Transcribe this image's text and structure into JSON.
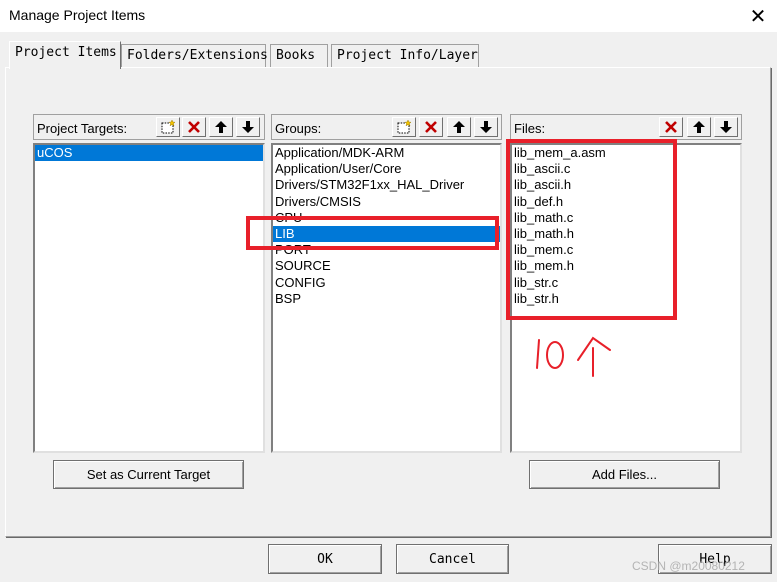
{
  "window": {
    "title": "Manage Project Items",
    "close_glyph": "✕"
  },
  "tabs": [
    {
      "label": "Project Items",
      "active": true
    },
    {
      "label": "Folders/Extensions",
      "active": false
    },
    {
      "label": "Books",
      "active": false
    },
    {
      "label": "Project Info/Layer",
      "active": false
    }
  ],
  "targets": {
    "header": "Project Targets:",
    "toolbar": [
      "new-icon",
      "delete-icon",
      "move-up-icon",
      "move-down-icon"
    ],
    "items": [
      {
        "label": "uCOS",
        "selected": true
      }
    ]
  },
  "groups": {
    "header": "Groups:",
    "toolbar": [
      "new-icon",
      "delete-icon",
      "move-up-icon",
      "move-down-icon"
    ],
    "items": [
      {
        "label": "Application/MDK-ARM",
        "selected": false
      },
      {
        "label": "Application/User/Core",
        "selected": false
      },
      {
        "label": "Drivers/STM32F1xx_HAL_Driver",
        "selected": false
      },
      {
        "label": "Drivers/CMSIS",
        "selected": false
      },
      {
        "label": "CPU",
        "selected": false
      },
      {
        "label": "LIB",
        "selected": true
      },
      {
        "label": "PORT",
        "selected": false
      },
      {
        "label": "SOURCE",
        "selected": false
      },
      {
        "label": "CONFIG",
        "selected": false
      },
      {
        "label": "BSP",
        "selected": false
      }
    ]
  },
  "files": {
    "header": "Files:",
    "toolbar": [
      "delete-icon",
      "move-up-icon",
      "move-down-icon"
    ],
    "items": [
      {
        "label": "lib_mem_a.asm"
      },
      {
        "label": "lib_ascii.c"
      },
      {
        "label": "lib_ascii.h"
      },
      {
        "label": "lib_def.h"
      },
      {
        "label": "lib_math.c"
      },
      {
        "label": "lib_math.h"
      },
      {
        "label": "lib_mem.c"
      },
      {
        "label": "lib_mem.h"
      },
      {
        "label": "lib_str.c"
      },
      {
        "label": "lib_str.h"
      }
    ]
  },
  "buttons": {
    "set_current_target": "Set as Current Target",
    "add_files": "Add Files...",
    "ok": "OK",
    "cancel": "Cancel",
    "help": "Help"
  },
  "annotation": {
    "handwritten_text": "10个",
    "color": "#e8202a"
  },
  "watermark": "CSDN @m20080212",
  "colors": {
    "selection": "#0078d7",
    "annotation_red": "#e8202a",
    "dialog_bg": "#f0f0f0"
  }
}
